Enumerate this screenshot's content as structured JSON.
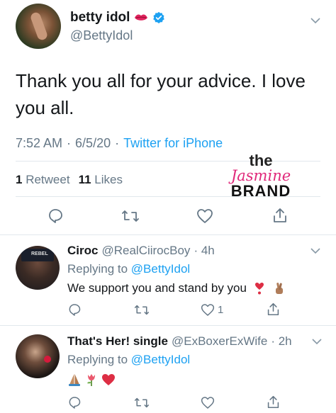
{
  "tweet": {
    "author": "betty idol",
    "handle": "@BettyIdol",
    "text": "Thank you all for your advice. I love you all.",
    "time": "7:52 AM",
    "date": "6/5/20",
    "separator": "·",
    "source": "Twitter for iPhone",
    "retweets_count": "1",
    "retweets_label": "Retweet",
    "likes_count": "11",
    "likes_label": "Likes"
  },
  "watermark": {
    "line1": "the",
    "line2": "Jasmine",
    "line3": "BRAND"
  },
  "replies": [
    {
      "author": "Ciroc",
      "handle": "@RealCiirocBoy",
      "time": "· 4h",
      "replying_label": "Replying to",
      "replying_to": "@BettyIdol",
      "text": "We support you and stand by you",
      "emojis": [
        "heart-exclamation",
        "crossed-fingers"
      ],
      "like_count": "1"
    },
    {
      "author": "That's Her! single",
      "handle": "@ExBoxerExWife",
      "time": "· 2h",
      "replying_label": "Replying to",
      "replying_to": "@BettyIdol",
      "text": "",
      "emojis": [
        "folded-hands",
        "tulip",
        "red-heart"
      ],
      "like_count": ""
    }
  ],
  "colors": {
    "accent": "#1da1f2",
    "muted": "#657786",
    "text": "#14171a",
    "divider": "#e1e8ed",
    "brand_pink": "#e0287a"
  }
}
